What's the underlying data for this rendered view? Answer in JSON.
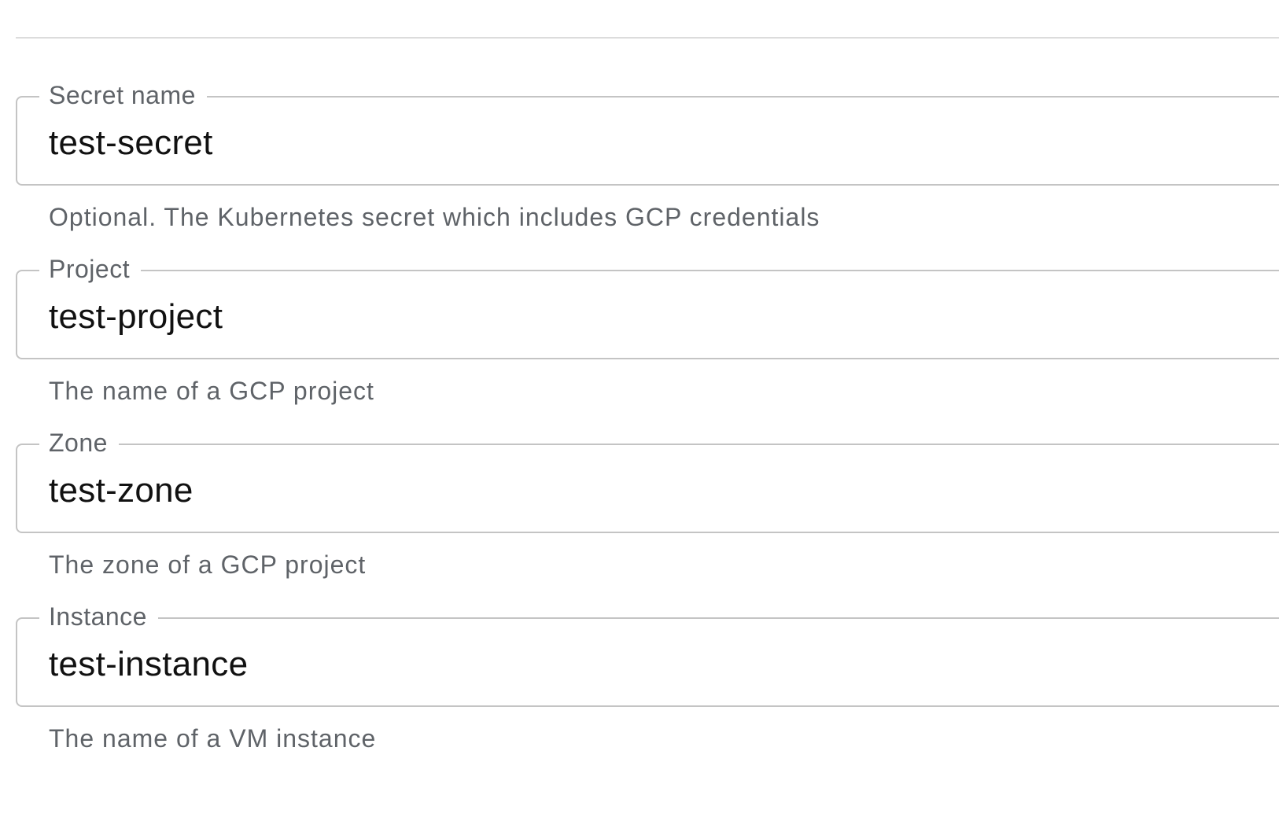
{
  "form": {
    "fields": [
      {
        "label": "Secret name",
        "value": "test-secret",
        "helper": "Optional. The Kubernetes secret which includes GCP credentials"
      },
      {
        "label": "Project",
        "value": "test-project",
        "helper": "The name of a GCP project"
      },
      {
        "label": "Zone",
        "value": "test-zone",
        "helper": "The zone of a GCP project"
      },
      {
        "label": "Instance",
        "value": "test-instance",
        "helper": "The name of a VM instance"
      }
    ]
  },
  "colors": {
    "outline": "#c4c4c4",
    "label_text": "#5f6368",
    "value_text": "#111111",
    "divider": "#dcdcdc"
  }
}
